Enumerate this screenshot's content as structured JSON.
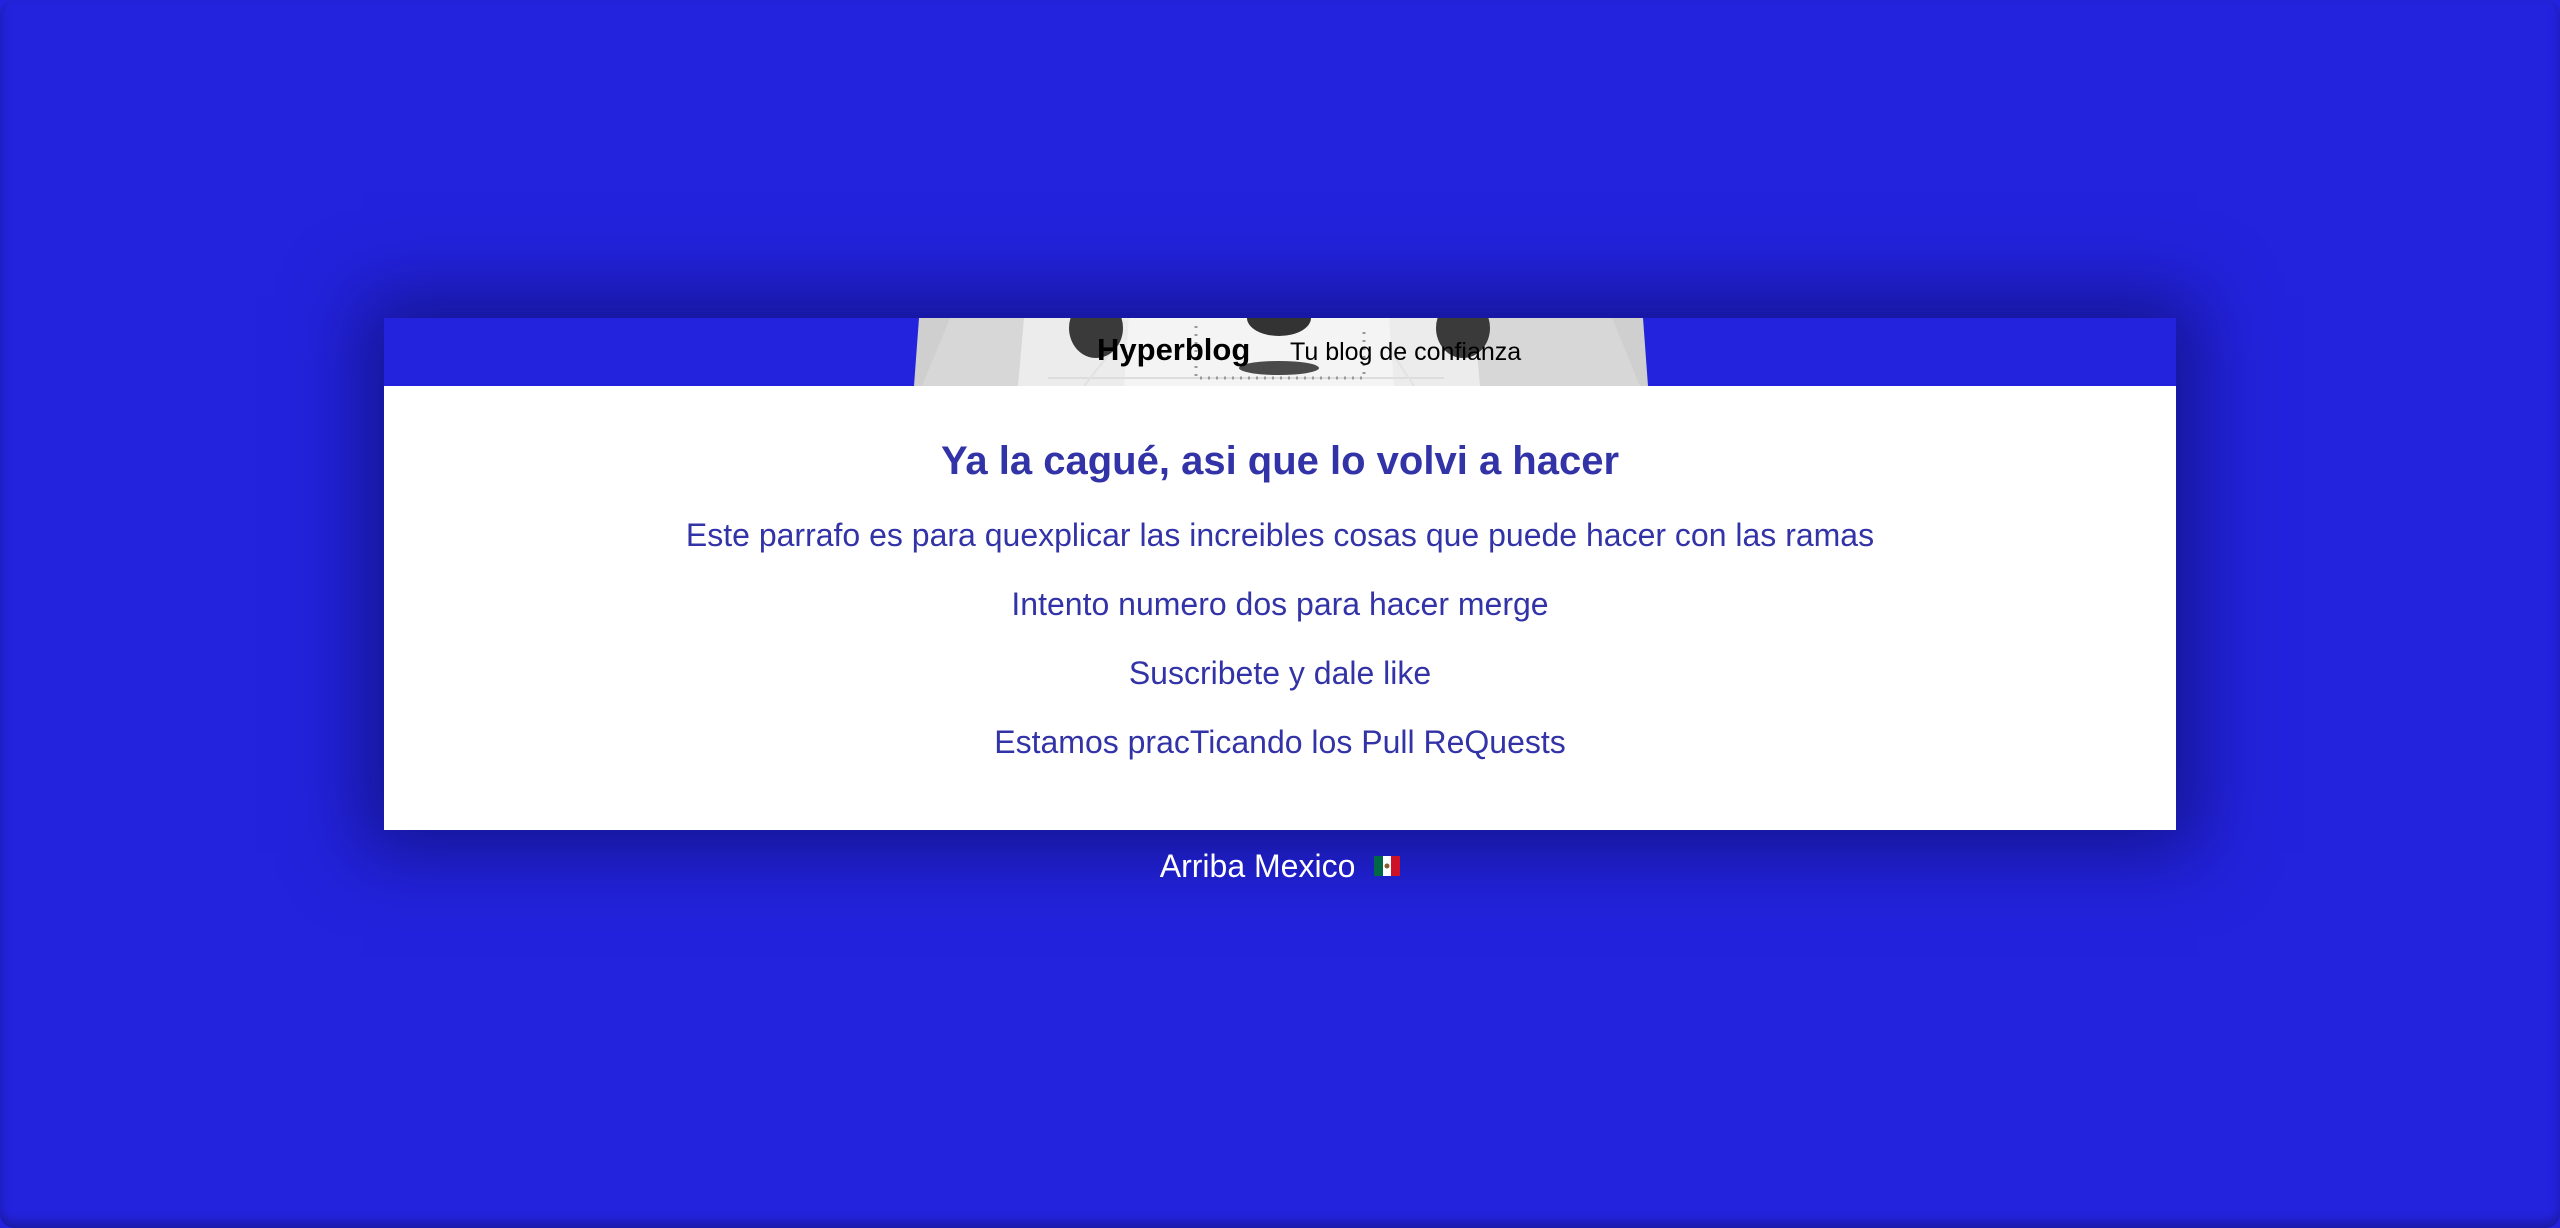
{
  "header": {
    "brand": "Hyperblog",
    "tagline": "Tu blog de confianza"
  },
  "main": {
    "headline": "Ya la cagué, asi que lo volvi a hacer",
    "paragraphs": [
      "Este parrafo es para quexplicar las increibles cosas que puede hacer con las ramas",
      "Intento numero dos para hacer merge",
      "Suscribete y dale like",
      "Estamos pracTicando los Pull ReQuests"
    ]
  },
  "footer": {
    "text": "Arriba Mexico",
    "flag_icon": "mexico-flag-icon"
  },
  "colors": {
    "background": "#2323dd",
    "content_text": "#3333a8",
    "card_background": "#ffffff"
  }
}
